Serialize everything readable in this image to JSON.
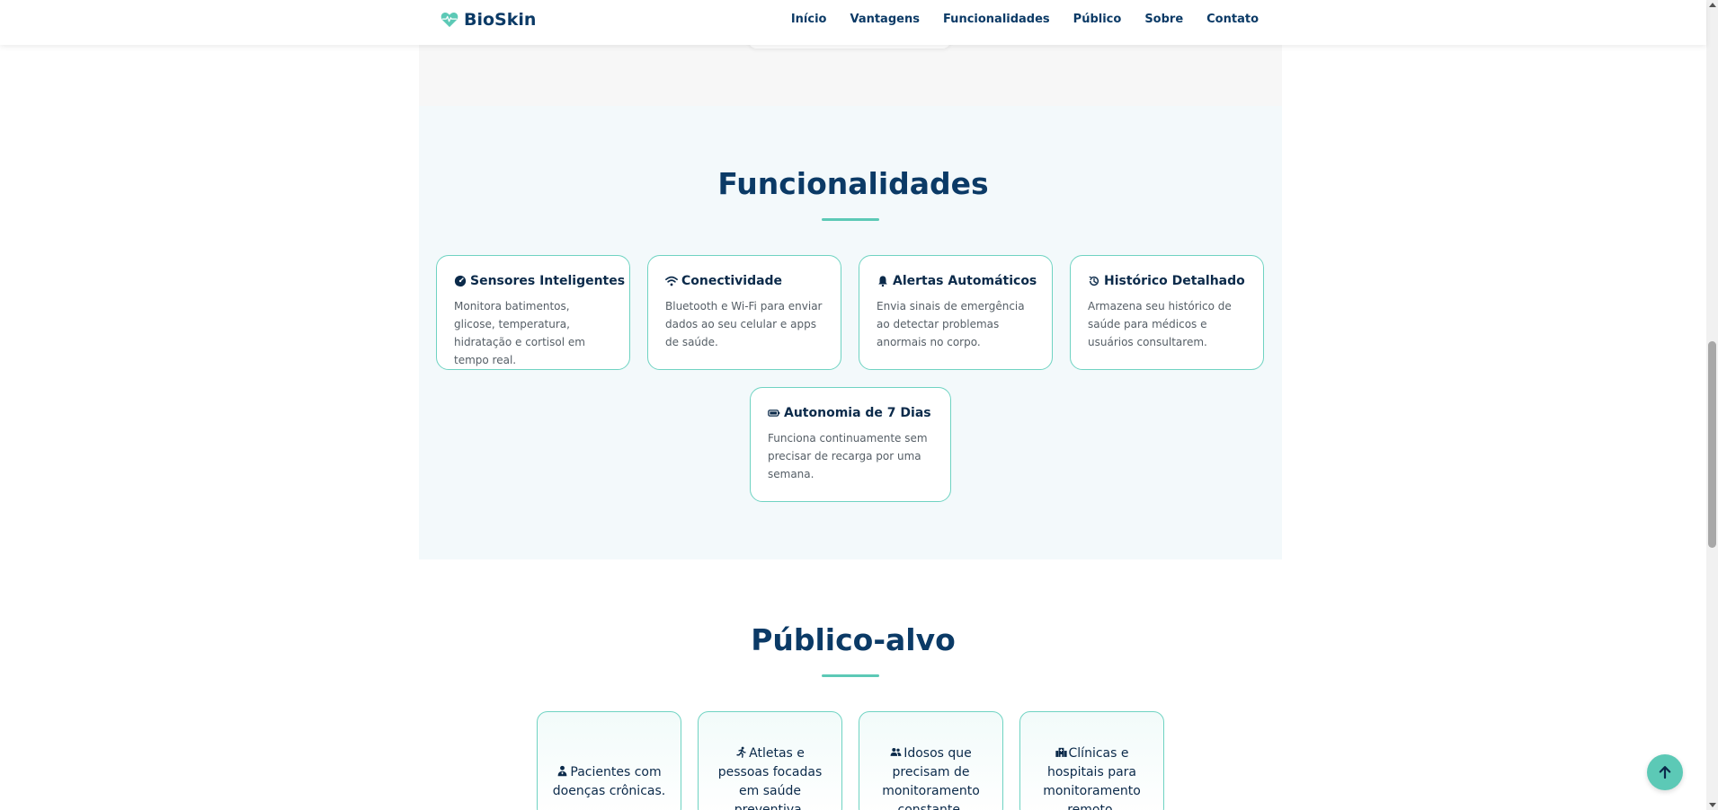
{
  "brand": {
    "name": "BioSkin",
    "icon": "heartbeat-icon"
  },
  "nav": {
    "items": [
      "Início",
      "Vantagens",
      "Funcionalidades",
      "Público",
      "Sobre",
      "Contato"
    ]
  },
  "features": {
    "title": "Funcionalidades",
    "cards": [
      {
        "icon": "sensor-gauge-icon",
        "title": "Sensores Inteligentes",
        "desc": "Monitora batimentos, glicose, temperatura, hidratação e cortisol em tempo real."
      },
      {
        "icon": "wifi-icon",
        "title": "Conectividade",
        "desc": "Bluetooth e Wi-Fi para enviar dados ao seu celular e apps de saúde."
      },
      {
        "icon": "bell-icon",
        "title": "Alertas Automáticos",
        "desc": "Envia sinais de emergência ao detectar problemas anormais no corpo."
      },
      {
        "icon": "history-icon",
        "title": "Histórico Detalhado",
        "desc": "Armazena seu histórico de saúde para médicos e usuários consultarem."
      },
      {
        "icon": "battery-icon",
        "title": "Autonomia de 7 Dias",
        "desc": "Funciona continuamente sem precisar de recarga por uma semana."
      }
    ]
  },
  "audience": {
    "title": "Público-alvo",
    "cards": [
      {
        "icon": "patient-icon",
        "text": "Pacientes com doenças crônicas."
      },
      {
        "icon": "runner-icon",
        "text": "Atletas e pessoas focadas em saúde preventiva."
      },
      {
        "icon": "users-icon",
        "text": "Idosos que precisam de monitoramento constante."
      },
      {
        "icon": "hospital-icon",
        "text": "Clínicas e hospitais para monitoramento remoto."
      }
    ]
  },
  "back_to_top": {
    "icon": "arrow-up-icon"
  },
  "colors": {
    "accent": "#5cc9b6",
    "primary": "#0b3a66",
    "section_bg": "#f3f9fb"
  }
}
